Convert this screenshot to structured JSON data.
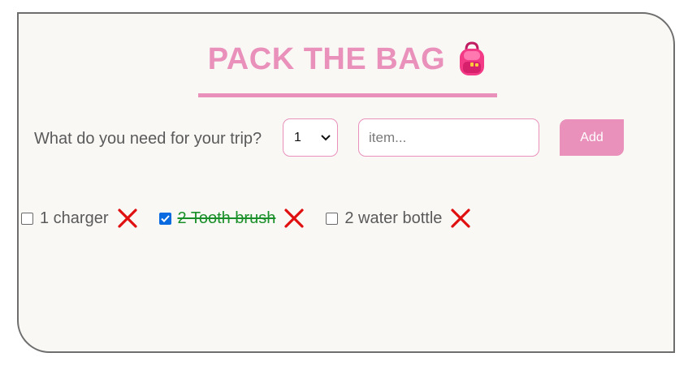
{
  "header": {
    "title": "PACK THE BAG",
    "title_icon": "backpack-emoji"
  },
  "form": {
    "question": "What do you need for your trip?",
    "quantity_selected": "1",
    "item_placeholder": "item...",
    "add_label": "Add"
  },
  "items": [
    {
      "quantity": "1",
      "name": "charger",
      "label": "1 charger",
      "packed": false
    },
    {
      "quantity": "2",
      "name": "Tooth brush",
      "label": "2 Tooth brush",
      "packed": true
    },
    {
      "quantity": "2",
      "name": "water bottle",
      "label": "2 water bottle",
      "packed": false
    }
  ],
  "colors": {
    "accent": "#e991bb",
    "packed_text": "#1b8f2a",
    "delete": "#e01010",
    "checkbox_checked": "#0a6ae0"
  }
}
